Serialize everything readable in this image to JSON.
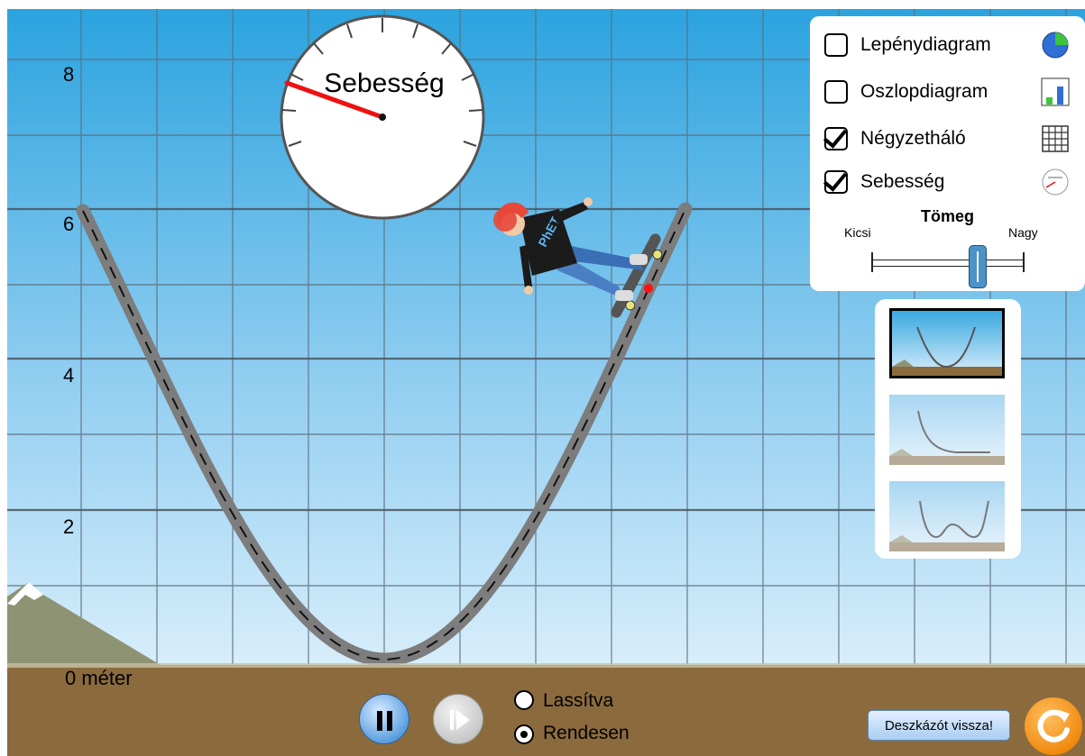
{
  "axis": {
    "labels": [
      "8",
      "6",
      "4",
      "2"
    ],
    "zero_label": "0 méter"
  },
  "speedometer": {
    "title": "Sebesség",
    "needle_color": "#ee1111"
  },
  "skater": {
    "shirt_text": "PhET",
    "helmet_color": "#e8483a",
    "shirt_color": "#1b1b1b",
    "pants_color": "#3b6fb5"
  },
  "panel": {
    "items": [
      {
        "label": "Lepénydiagram",
        "checked": false,
        "icon": "pie-chart-icon"
      },
      {
        "label": "Oszlopdiagram",
        "checked": false,
        "icon": "bar-chart-icon"
      },
      {
        "label": "Négyzetháló",
        "checked": true,
        "icon": "grid-icon"
      },
      {
        "label": "Sebesség",
        "checked": true,
        "icon": "speedometer-icon"
      }
    ],
    "mass": {
      "title": "Tömeg",
      "min_label": "Kicsi",
      "max_label": "Nagy",
      "value_fraction": 0.7
    }
  },
  "tracks": {
    "selected_index": 0
  },
  "playback": {
    "speed_options": [
      {
        "label": "Lassítva",
        "selected": false
      },
      {
        "label": "Rendesen",
        "selected": true
      }
    ],
    "state": "playing"
  },
  "buttons": {
    "return_skater": "Deszkázót vissza!"
  },
  "colors": {
    "sky_top": "#2ba3df",
    "sky_bottom": "#d4ecfa",
    "ground": "#8b6b3e",
    "track": "#7d7d7d",
    "accent_blue": "#4b93c8",
    "reset_orange": "#f08a10"
  }
}
